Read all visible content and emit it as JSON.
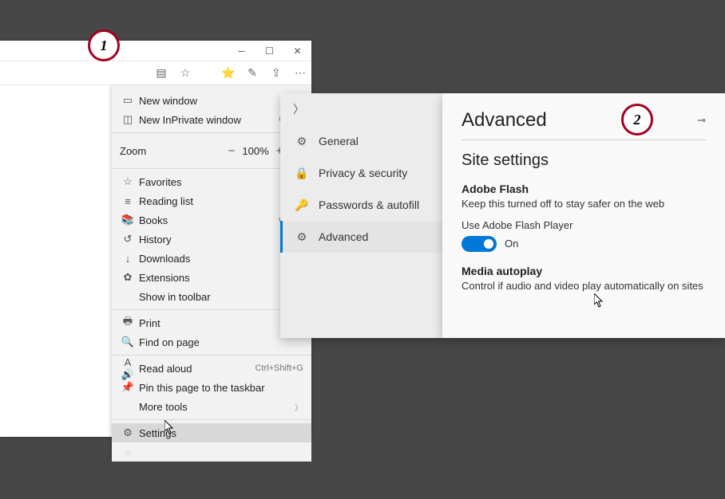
{
  "callouts": {
    "one": "1",
    "two": "2"
  },
  "menu": {
    "new_window": "New window",
    "new_inprivate": "New InPrivate window",
    "new_inprivate_cut": "Ctrl+S",
    "zoom_label": "Zoom",
    "zoom_value": "100%",
    "favorites": "Favorites",
    "reading_list": "Reading list",
    "books": "Books",
    "books_cut": "Ctrl+S",
    "history": "History",
    "downloads": "Downloads",
    "extensions": "Extensions",
    "show_in_toolbar": "Show in toolbar",
    "print": "Print",
    "find_on_page": "Find on page",
    "read_aloud": "Read aloud",
    "read_aloud_cut": "Ctrl+Shift+G",
    "pin_taskbar": "Pin this page to the taskbar",
    "more_tools": "More tools",
    "settings": "Settings"
  },
  "settings_nav": {
    "general": "General",
    "privacy": "Privacy & security",
    "passwords": "Passwords & autofill",
    "advanced": "Advanced"
  },
  "advanced": {
    "title": "Advanced",
    "section": "Site settings",
    "flash_title": "Adobe Flash",
    "flash_desc": "Keep this turned off to stay safer on the web",
    "flash_toggle_label": "Use Adobe Flash Player",
    "flash_state": "On",
    "media_title": "Media autoplay",
    "media_desc": "Control if audio and video play automatically on sites"
  }
}
